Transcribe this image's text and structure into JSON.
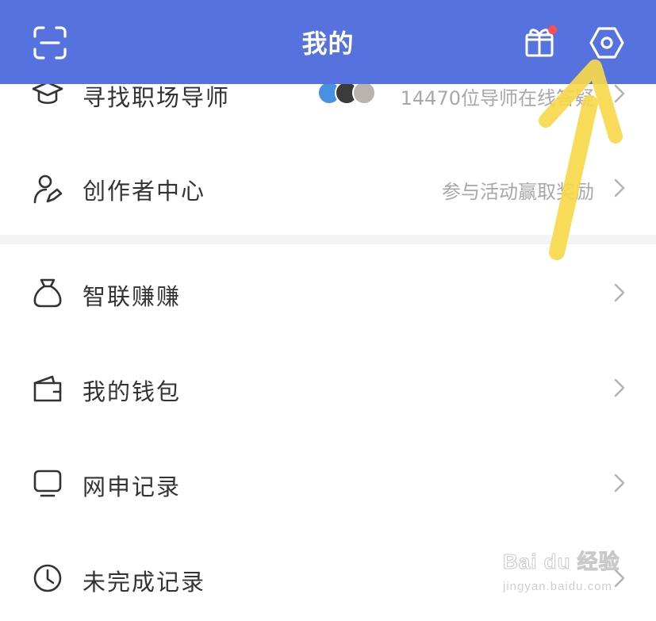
{
  "header": {
    "title": "我的",
    "icons": [
      "scan-icon",
      "gift-icon",
      "settings-icon"
    ],
    "background": "#5672df"
  },
  "menu": {
    "group1": [
      {
        "label": "寻找职场导师",
        "hint": "14470位导师在线答疑",
        "icon": "mortarboard-icon"
      },
      {
        "label": "创作者中心",
        "hint": "参与活动赢取奖励",
        "icon": "creator-icon"
      }
    ],
    "group2": [
      {
        "label": "智联赚赚",
        "hint": "",
        "icon": "money-bag-icon"
      },
      {
        "label": "我的钱包",
        "hint": "",
        "icon": "wallet-icon"
      },
      {
        "label": "网申记录",
        "hint": "",
        "icon": "monitor-icon"
      },
      {
        "label": "未完成记录",
        "hint": "",
        "icon": "clock-icon"
      }
    ]
  },
  "watermark": {
    "brand": "Bai du 经验",
    "url": "jingyan.baidu.com"
  },
  "colors": {
    "accent": "#5672df",
    "arrow": "#f7d84a",
    "badge": "#ff4d4f"
  }
}
